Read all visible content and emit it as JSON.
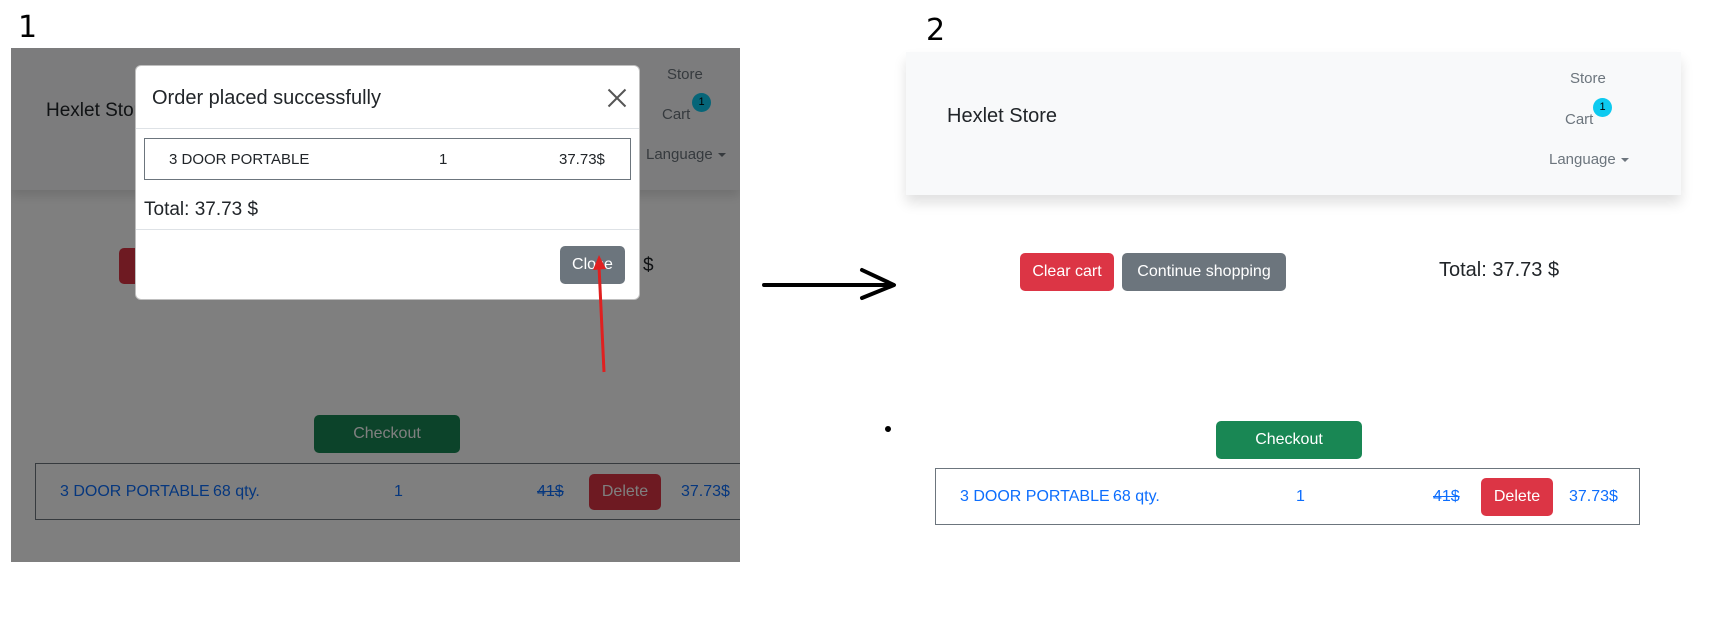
{
  "steps": {
    "first": "1",
    "second": "2"
  },
  "store": {
    "brand": "Hexlet Store",
    "nav": {
      "store": "Store",
      "cart": "Cart",
      "cart_count": "1",
      "language": "Language"
    }
  },
  "cart": {
    "clear_label": "Clear cart",
    "continue_label": "Continue shopping",
    "total_label": "Total: 37.73 $",
    "checkout_label": "Checkout",
    "item": {
      "name": "3 DOOR PORTABLE",
      "stock": "68 qty.",
      "quantity": "1",
      "old_price": "41$",
      "delete_label": "Delete",
      "price": "37.73$"
    }
  },
  "modal": {
    "title": "Order placed successfully",
    "item": {
      "name": "3 DOOR PORTABLE",
      "quantity": "1",
      "price": "37.73$"
    },
    "total": "Total: 37.73 $",
    "close_label": "Close"
  },
  "colors": {
    "danger": "#dc3545",
    "secondary": "#6c757d",
    "success": "#198754",
    "link": "#0d6efd",
    "badge": "#0dcaf0",
    "annotation_arrow": "#e02020"
  }
}
